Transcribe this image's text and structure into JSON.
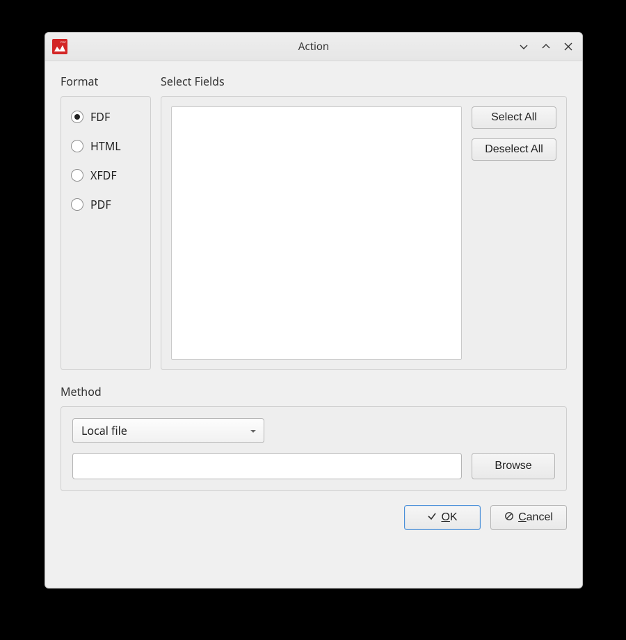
{
  "window": {
    "title": "Action"
  },
  "format": {
    "heading": "Format",
    "options": [
      "FDF",
      "HTML",
      "XFDF",
      "PDF"
    ],
    "selected": "FDF"
  },
  "fields": {
    "heading": "Select Fields",
    "select_all_label": "Select All",
    "deselect_all_label": "Deselect All"
  },
  "method": {
    "heading": "Method",
    "combo_value": "Local file",
    "path_value": "",
    "browse_label": "Browse"
  },
  "buttons": {
    "ok_label": "OK",
    "cancel_label": "Cancel"
  }
}
